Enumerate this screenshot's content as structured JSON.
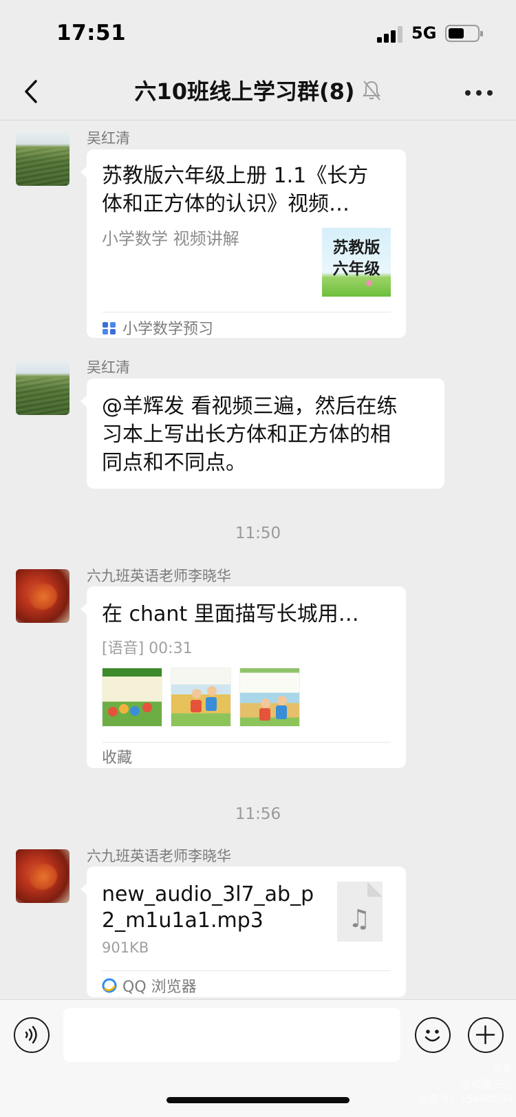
{
  "status": {
    "time": "17:51",
    "network": "5G"
  },
  "nav": {
    "title": "六10班线上学习群(8)"
  },
  "messages": [
    {
      "sender": "吴红清",
      "card": {
        "title_line1": "苏教版六年级上册 1.1《长方",
        "title_line2": "体和正方体的认识》视频…",
        "subtitle": "小学数学   视频讲解",
        "thumb_line1": "苏教版",
        "thumb_line2": "六年级",
        "source": "小学数学预习"
      }
    },
    {
      "sender": "吴红清",
      "text_line1": "@羊辉发 看视频三遍，然后在练",
      "text_line2": "习本上写出长方体和正方体的相",
      "text_line3": "同点和不同点。"
    },
    {
      "timestamp": "11:50",
      "sender": "六九班英语老师李晓华",
      "card": {
        "title": "在 chant 里面描写长城用…",
        "voice_label": "[语音] 00:31",
        "footer": "收藏"
      }
    },
    {
      "timestamp": "11:56",
      "sender": "六九班英语老师李晓华",
      "file": {
        "name_line1": "new_audio_3l7_ab_p",
        "name_line2": "2_m1u1a1.mp3",
        "size": "901KB",
        "source": "QQ 浏览器"
      }
    }
  ],
  "input": {
    "value": "",
    "placeholder": ""
  },
  "watermark": {
    "line1": "头条",
    "line2": "@初樊三小",
    "line3": "头条号：15480000"
  }
}
